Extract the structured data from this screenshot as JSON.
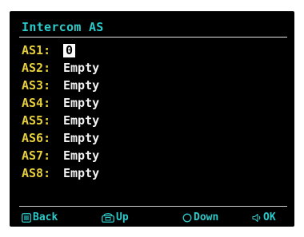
{
  "colors": {
    "title": "#2ec9c9",
    "slot_label": "#e6cf3a",
    "slot_value": "#f2f2f2",
    "softkey": "#2ec9c9",
    "background": "#000000"
  },
  "header": {
    "title": "Intercom AS"
  },
  "slots": [
    {
      "label": "AS1:",
      "value": "0",
      "selected": true
    },
    {
      "label": "AS2:",
      "value": "Empty"
    },
    {
      "label": "AS3:",
      "value": "Empty"
    },
    {
      "label": "AS4:",
      "value": "Empty"
    },
    {
      "label": "AS5:",
      "value": "Empty"
    },
    {
      "label": "AS6:",
      "value": "Empty"
    },
    {
      "label": "AS7:",
      "value": "Empty"
    },
    {
      "label": "AS8:",
      "value": "Empty"
    }
  ],
  "softkeys": [
    {
      "label": "Back",
      "icon": "menu-button-icon"
    },
    {
      "label": "Up",
      "icon": "phone-button-icon"
    },
    {
      "label": "Down",
      "icon": "circle-button-icon"
    },
    {
      "label": "OK",
      "icon": "speaker-button-icon"
    }
  ]
}
